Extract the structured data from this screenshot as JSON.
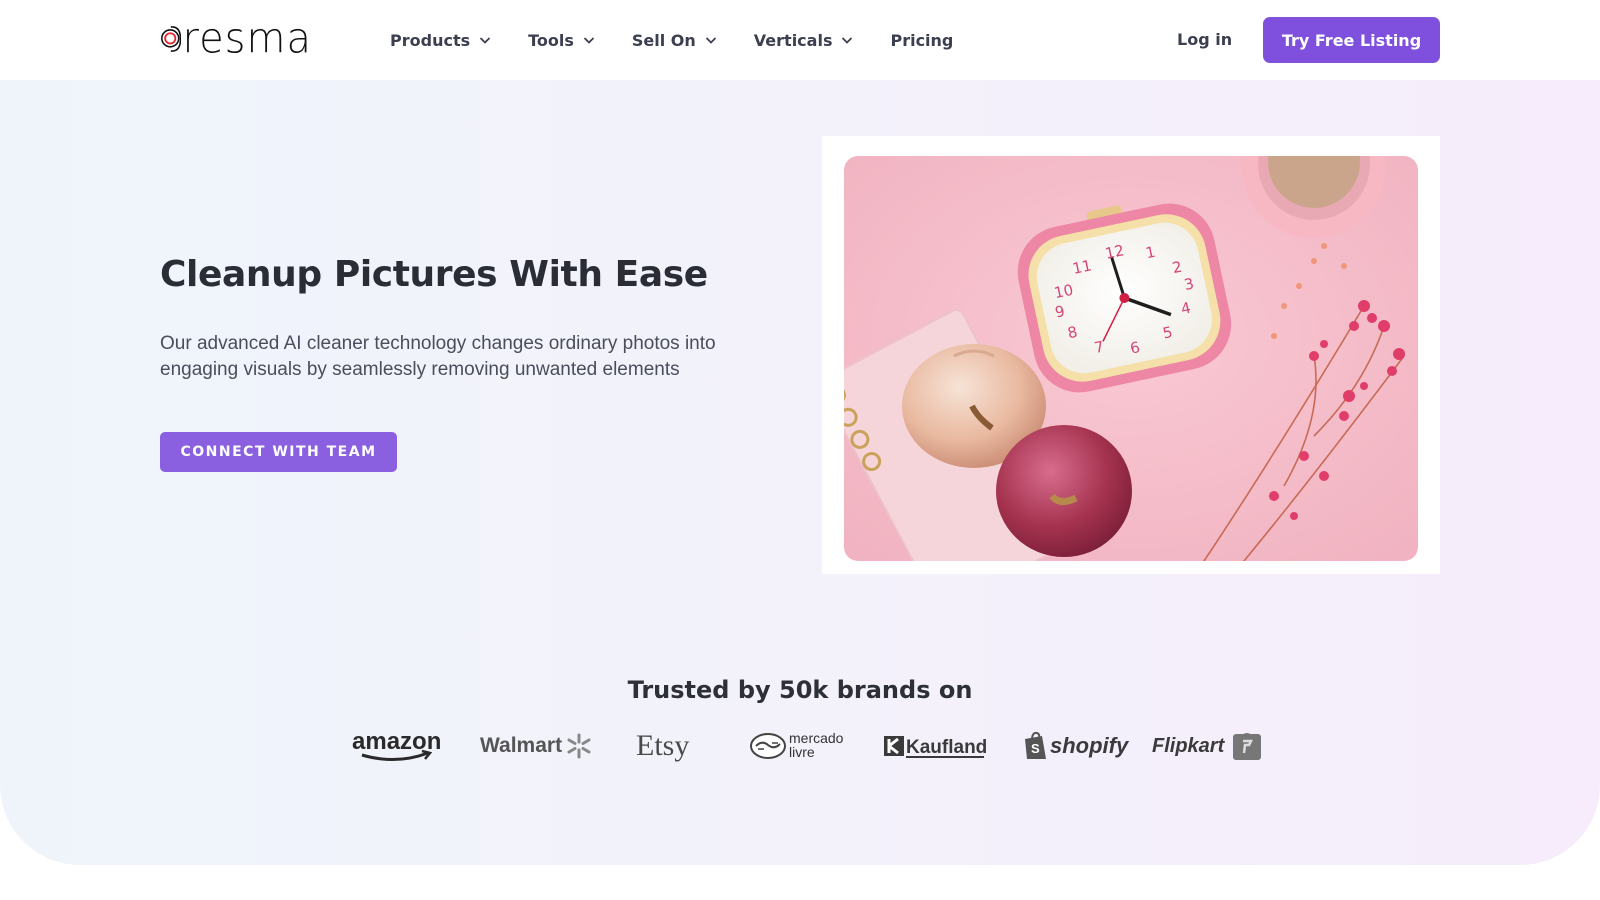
{
  "brand": {
    "name": "Dresma",
    "logo_text": "resma"
  },
  "nav": {
    "items": [
      {
        "label": "Products",
        "has_dropdown": true
      },
      {
        "label": "Tools",
        "has_dropdown": true
      },
      {
        "label": "Sell On",
        "has_dropdown": true
      },
      {
        "label": "Verticals",
        "has_dropdown": true
      },
      {
        "label": "Pricing",
        "has_dropdown": false
      }
    ],
    "login_label": "Log in",
    "cta_label": "Try Free Listing"
  },
  "hero": {
    "title": "Cleanup Pictures With Ease",
    "description": "Our advanced AI cleaner technology changes ordinary photos into engaging visuals by seamlessly removing unwanted elements",
    "cta_label": "CONNECT WITH TEAM"
  },
  "trusted": {
    "heading": "Trusted by 50k brands on",
    "brands": [
      "amazon",
      "Walmart",
      "Etsy",
      "mercado livre",
      "Kaufland",
      "shopify",
      "Flipkart"
    ]
  },
  "colors": {
    "accent": "#7f4fde",
    "cta": "#8a5fe0",
    "text_dark": "#2a2d35",
    "nav_text": "#3b3f4f"
  }
}
